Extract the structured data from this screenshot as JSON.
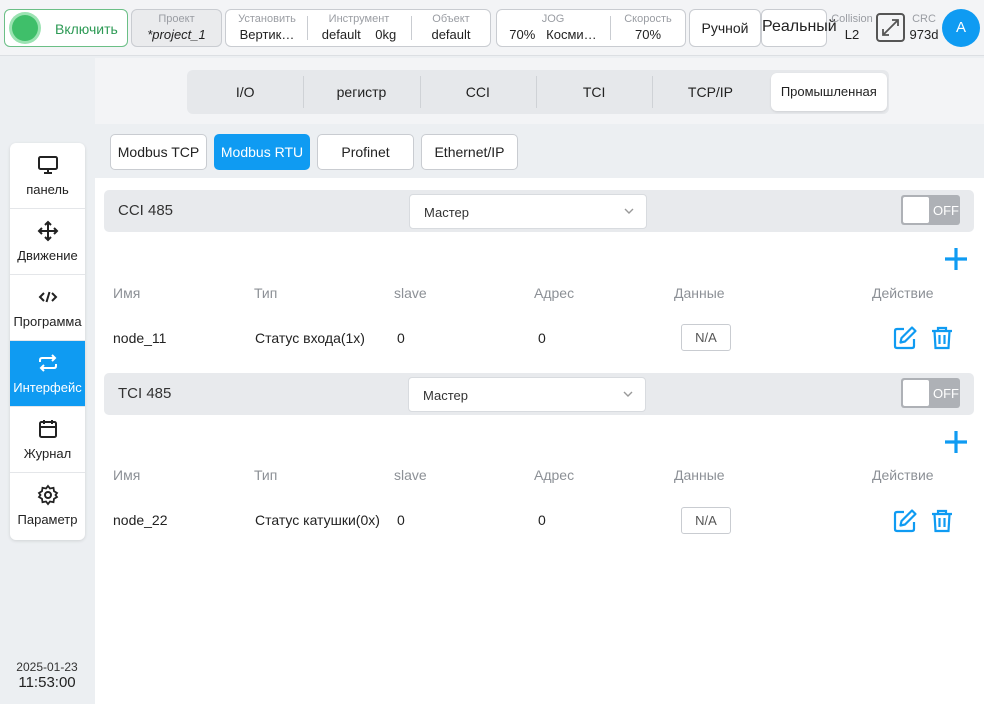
{
  "topbar": {
    "enable_label": "Включить",
    "project": {
      "caption": "Проект",
      "value": "*project_1"
    },
    "install": {
      "caption": "Установить",
      "value": "Вертик…"
    },
    "tool": {
      "caption": "Инструмент",
      "value": "default",
      "weight": "0kg"
    },
    "object": {
      "caption": "Объект",
      "value": "default"
    },
    "jog": {
      "caption": "JOG",
      "value": "70%",
      "frame": "Косми…"
    },
    "speed": {
      "caption": "Скорость",
      "value": "70%"
    },
    "mode_label": "Ручной",
    "real_label": "Реальный",
    "collision": {
      "caption": "Collision",
      "value": "L2"
    },
    "crc": {
      "caption": "CRC",
      "value": "973d"
    },
    "avatar_letter": "A"
  },
  "sidebar": {
    "items": [
      {
        "label": "панель",
        "icon": "monitor-icon"
      },
      {
        "label": "Движение",
        "icon": "move-icon"
      },
      {
        "label": "Программа",
        "icon": "code-icon"
      },
      {
        "label": "Интерфейс",
        "icon": "interface-icon",
        "active": true
      },
      {
        "label": "Журнал",
        "icon": "calendar-icon"
      },
      {
        "label": "Параметр",
        "icon": "gear-icon"
      }
    ],
    "date": "2025-01-23",
    "time": "11:53:00"
  },
  "tabs": [
    {
      "label": "I/O"
    },
    {
      "label": "регистр"
    },
    {
      "label": "CCI"
    },
    {
      "label": "TCI"
    },
    {
      "label": "TCP/IP"
    },
    {
      "label": "Промышленная",
      "active": true
    }
  ],
  "subtabs": [
    {
      "label": "Modbus TCP"
    },
    {
      "label": "Modbus RTU",
      "active": true
    },
    {
      "label": "Profinet"
    },
    {
      "label": "Ethernet/IP"
    }
  ],
  "columns": {
    "name": "Имя",
    "type": "Тип",
    "slave": "slave",
    "address": "Адрес",
    "data": "Данные",
    "action": "Действие"
  },
  "sections": [
    {
      "title": "CCI 485",
      "role": "Мастер",
      "toggle": "OFF",
      "rows": [
        {
          "name": "node_11",
          "type": "Статус входа(1x)",
          "slave": "0",
          "address": "0",
          "data": "N/A"
        }
      ]
    },
    {
      "title": "TCI 485",
      "role": "Мастер",
      "toggle": "OFF",
      "rows": [
        {
          "name": "node_22",
          "type": "Статус катушки(0x)",
          "slave": "0",
          "address": "0",
          "data": "N/A"
        }
      ]
    }
  ],
  "colors": {
    "accent": "#0f9bf2",
    "enable_green": "#3fbf6a",
    "toggle_off": "#aeb1b6"
  }
}
